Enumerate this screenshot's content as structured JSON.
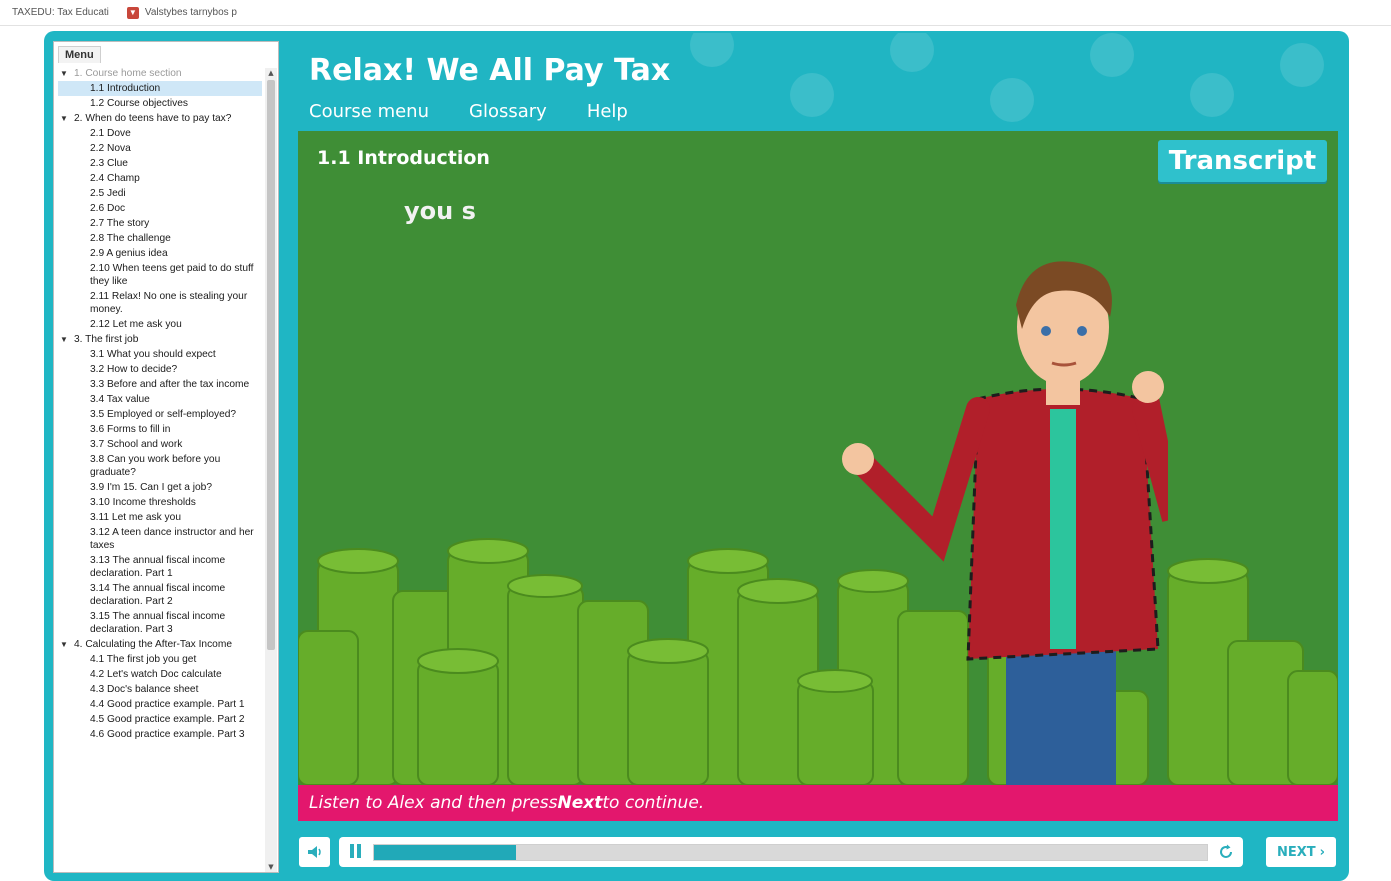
{
  "bookmarks": [
    {
      "label": "TAXEDU: Tax Educati"
    },
    {
      "label": "Valstybes tarnybos p",
      "icon": "shield-icon"
    }
  ],
  "menu": {
    "tab_label": "Menu",
    "sections": [
      {
        "label": "1. Course home section",
        "muted": true,
        "items": [
          {
            "label": "1.1 Introduction",
            "active": true
          },
          {
            "label": "1.2 Course objectives"
          }
        ]
      },
      {
        "label": "2. When do teens have to pay tax?",
        "items": [
          {
            "label": "2.1 Dove"
          },
          {
            "label": "2.2 Nova"
          },
          {
            "label": "2.3 Clue"
          },
          {
            "label": "2.4 Champ"
          },
          {
            "label": "2.5 Jedi"
          },
          {
            "label": "2.6 Doc"
          },
          {
            "label": "2.7 The story"
          },
          {
            "label": "2.8 The challenge"
          },
          {
            "label": "2.9 A genius idea"
          },
          {
            "label": "2.10 When teens get paid to do stuff they like"
          },
          {
            "label": "2.11 Relax! No one is stealing your money."
          },
          {
            "label": "2.12 Let me ask you"
          }
        ]
      },
      {
        "label": "3. The first job",
        "items": [
          {
            "label": "3.1 What you should expect"
          },
          {
            "label": "3.2 How to decide?"
          },
          {
            "label": "3.3 Before and after the tax income"
          },
          {
            "label": "3.4 Tax value"
          },
          {
            "label": "3.5 Employed or self-employed?"
          },
          {
            "label": "3.6 Forms to fill in"
          },
          {
            "label": "3.7 School and work"
          },
          {
            "label": "3.8 Can you work before you graduate?"
          },
          {
            "label": "3.9 I'm 15. Can I get a job?"
          },
          {
            "label": "3.10 Income thresholds"
          },
          {
            "label": "3.11 Let me ask you"
          },
          {
            "label": "3.12 A teen dance instructor and her taxes"
          },
          {
            "label": "3.13 The annual fiscal income declaration. Part 1"
          },
          {
            "label": "3.14 The annual fiscal income declaration. Part 2"
          },
          {
            "label": "3.15 The annual fiscal income declaration. Part 3"
          }
        ]
      },
      {
        "label": "4. Calculating the After-Tax Income",
        "items": [
          {
            "label": "4.1 The first job you get"
          },
          {
            "label": "4.2 Let's watch Doc calculate"
          },
          {
            "label": "4.3 Doc's balance sheet"
          },
          {
            "label": "4.4 Good practice example. Part 1"
          },
          {
            "label": "4.5 Good practice example. Part 2"
          },
          {
            "label": "4.6 Good practice example. Part 3"
          }
        ]
      }
    ]
  },
  "header": {
    "title": "Relax! We All Pay Tax",
    "nav": [
      "Course menu",
      "Glossary",
      "Help"
    ]
  },
  "slide": {
    "title": "1.1 Introduction",
    "caption": "you s",
    "transcript_label": "Transcript"
  },
  "instruction": {
    "before": "Listen to Alex and then press ",
    "bold": "Next",
    "after": " to continue."
  },
  "player": {
    "progress": 0.17,
    "next_label": "NEXT",
    "accent_color": "#21a9b8"
  },
  "colors": {
    "frame": "#1fb6c4",
    "stage": "#3f8e36",
    "instruction_bar": "#e3176d"
  }
}
